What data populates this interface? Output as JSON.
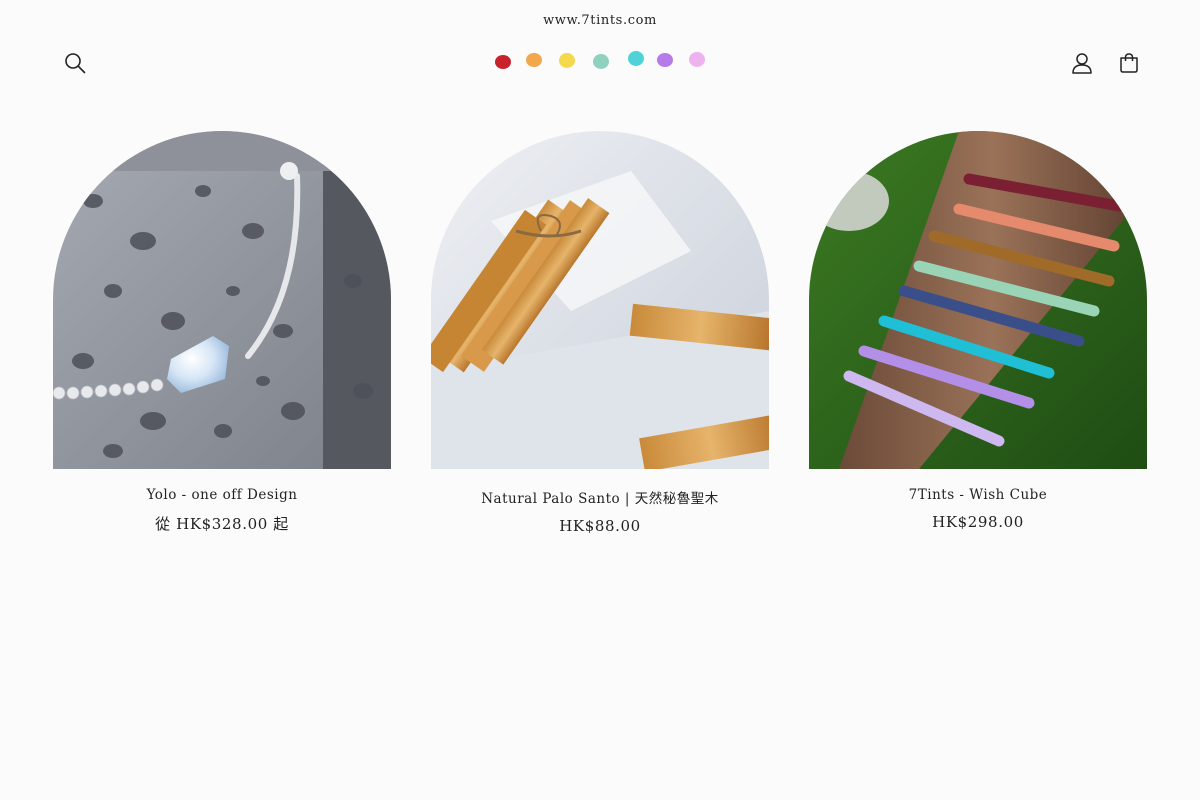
{
  "announcement": {
    "text": "www.7tints.com"
  },
  "header": {
    "logo": {
      "dot_colors": [
        "#c8232c",
        "#f2a74a",
        "#f4d94e",
        "#8fd0bf",
        "#4fd3d8",
        "#b57be8",
        "#eeb2ee"
      ]
    },
    "icons": {
      "search": "search-icon",
      "account": "account-icon",
      "cart": "cart-icon"
    }
  },
  "products": [
    {
      "title": "Yolo - one off Design",
      "price": "從 HK$328.00 起",
      "image": "moonstone-silver-bracelet-on-lava-stone"
    },
    {
      "title": "Natural Palo Santo | 天然秘魯聖木",
      "price": "HK$88.00",
      "image": "palo-santo-sticks-on-selenite"
    },
    {
      "title": "7Tints - Wish Cube",
      "price": "HK$298.00",
      "image": "seven-gemstone-bracelets-on-log"
    }
  ]
}
